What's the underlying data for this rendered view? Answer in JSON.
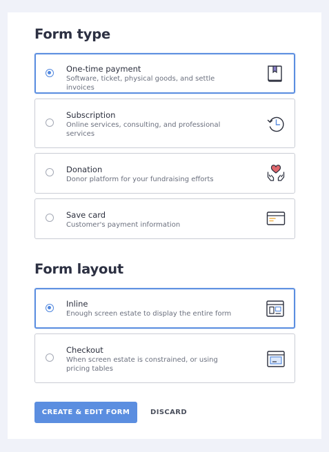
{
  "form_type": {
    "title": "Form type",
    "options": [
      {
        "title": "One-time payment",
        "description": "Software, ticket, physical goods, and settle invoices",
        "icon": "book-icon",
        "selected": true
      },
      {
        "title": "Subscription",
        "description": "Online services, consulting, and professional services",
        "icon": "history-clock-icon",
        "selected": false
      },
      {
        "title": "Donation",
        "description": "Donor platform for your fundraising efforts",
        "icon": "heart-hands-icon",
        "selected": false
      },
      {
        "title": "Save card",
        "description": "Customer's payment information",
        "icon": "credit-card-icon",
        "selected": false
      }
    ]
  },
  "form_layout": {
    "title": "Form layout",
    "options": [
      {
        "title": "Inline",
        "description": "Enough screen estate to display the entire form",
        "icon": "inline-layout-icon",
        "selected": true
      },
      {
        "title": "Checkout",
        "description": "When screen estate is constrained, or using pricing tables",
        "icon": "checkout-window-icon",
        "selected": false
      }
    ]
  },
  "actions": {
    "primary_label": "CREATE & EDIT FORM",
    "secondary_label": "DISCARD"
  },
  "colors": {
    "accent": "#5b8ee0",
    "background": "#f0f2f9",
    "heart": "#e0666c",
    "card_stripe": "#f0b24a"
  }
}
